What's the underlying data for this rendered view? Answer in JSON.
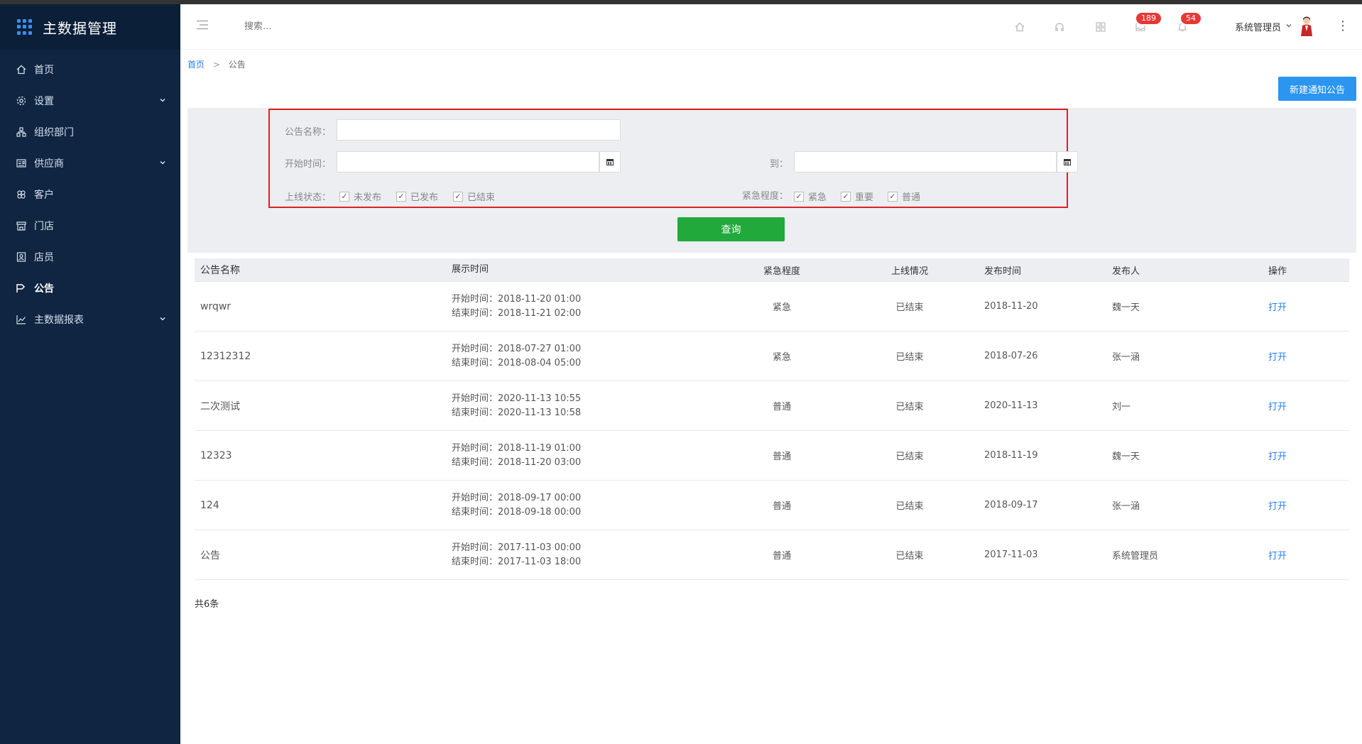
{
  "brand": {
    "title": "主数据管理"
  },
  "sidebar": {
    "items": [
      {
        "label": "首页",
        "icon": "home-icon",
        "has_children": false,
        "active": false
      },
      {
        "label": "设置",
        "icon": "gear-icon",
        "has_children": true,
        "active": false
      },
      {
        "label": "组织部门",
        "icon": "org-icon",
        "has_children": false,
        "active": false
      },
      {
        "label": "供应商",
        "icon": "supplier-icon",
        "has_children": true,
        "active": false
      },
      {
        "label": "客户",
        "icon": "customer-icon",
        "has_children": false,
        "active": false
      },
      {
        "label": "门店",
        "icon": "store-icon",
        "has_children": false,
        "active": false
      },
      {
        "label": "店员",
        "icon": "staff-icon",
        "has_children": false,
        "active": false
      },
      {
        "label": "公告",
        "icon": "announcement-icon",
        "has_children": false,
        "active": true
      },
      {
        "label": "主数据报表",
        "icon": "chart-icon",
        "has_children": true,
        "active": false
      }
    ]
  },
  "header": {
    "search_placeholder": "搜索...",
    "badges": {
      "messages": "189",
      "notifications": "54"
    },
    "user_name": "系统管理员"
  },
  "breadcrumb": {
    "home": "首页",
    "separator": ">",
    "current": "公告"
  },
  "toolbar": {
    "new_button": "新建通知公告"
  },
  "filter": {
    "name_label": "公告名称：",
    "name_value": "",
    "start_label": "开始时间：",
    "start_value": "",
    "to_label": "到：",
    "end_value": "",
    "status_label": "上线状态：",
    "status_options": [
      {
        "label": "未发布",
        "checked": true
      },
      {
        "label": "已发布",
        "checked": true
      },
      {
        "label": "已结束",
        "checked": true
      }
    ],
    "urgency_label": "紧急程度：",
    "urgency_options": [
      {
        "label": "紧急",
        "checked": true
      },
      {
        "label": "重要",
        "checked": true
      },
      {
        "label": "普通",
        "checked": true
      }
    ],
    "query_button": "查询"
  },
  "table": {
    "columns": [
      "公告名称",
      "展示时间",
      "紧急程度",
      "上线情况",
      "发布时间",
      "发布人",
      "操作"
    ],
    "rows": [
      {
        "name": "wrqwr",
        "start": "开始时间：2018-11-20 01:00",
        "end": "结束时间：2018-11-21 02:00",
        "urgency": "紧急",
        "status": "已结束",
        "publish_date": "2018-11-20",
        "publisher": "魏一天",
        "action": "打开"
      },
      {
        "name": "12312312",
        "start": "开始时间：2018-07-27 01:00",
        "end": "结束时间：2018-08-04 05:00",
        "urgency": "紧急",
        "status": "已结束",
        "publish_date": "2018-07-26",
        "publisher": "张一涵",
        "action": "打开"
      },
      {
        "name": "二次测试",
        "start": "开始时间：2020-11-13 10:55",
        "end": "结束时间：2020-11-13 10:58",
        "urgency": "普通",
        "status": "已结束",
        "publish_date": "2020-11-13",
        "publisher": "刘一",
        "action": "打开"
      },
      {
        "name": "12323",
        "start": "开始时间：2018-11-19 01:00",
        "end": "结束时间：2018-11-20 03:00",
        "urgency": "普通",
        "status": "已结束",
        "publish_date": "2018-11-19",
        "publisher": "魏一天",
        "action": "打开"
      },
      {
        "name": "124",
        "start": "开始时间：2018-09-17 00:00",
        "end": "结束时间：2018-09-18 00:00",
        "urgency": "普通",
        "status": "已结束",
        "publish_date": "2018-09-17",
        "publisher": "张一涵",
        "action": "打开"
      },
      {
        "name": "公告",
        "start": "开始时间：2017-11-03 00:00",
        "end": "结束时间：2017-11-03 18:00",
        "urgency": "普通",
        "status": "已结束",
        "publish_date": "2017-11-03",
        "publisher": "系统管理员",
        "action": "打开"
      }
    ],
    "total": "共6条"
  },
  "colors": {
    "sidebar_bg": "#0f2542",
    "primary_blue": "#2b95f0",
    "query_green": "#21a93b",
    "badge_red": "#e53935",
    "highlight_border": "#e02020"
  }
}
